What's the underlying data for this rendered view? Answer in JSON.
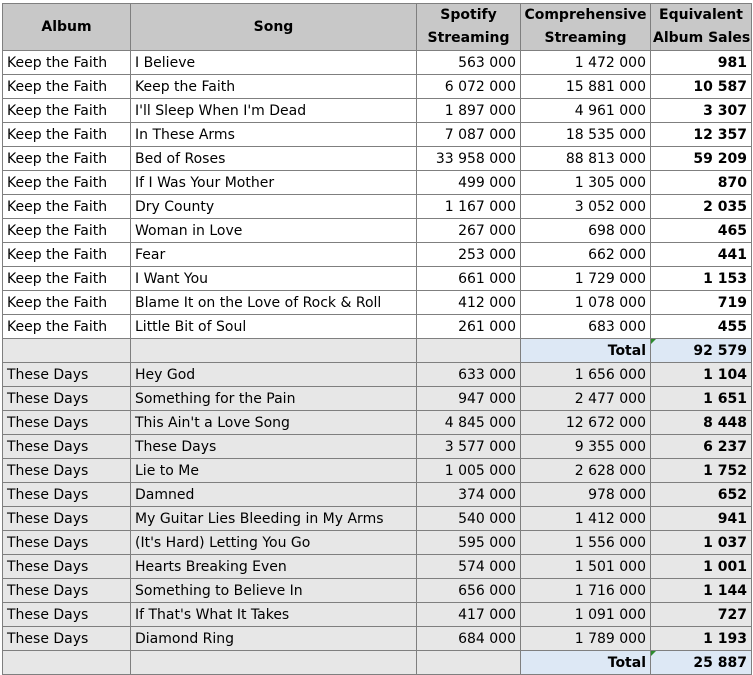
{
  "headers": {
    "album": "Album",
    "song": "Song",
    "spotify_l1": "Spotify",
    "spotify_l2": "Streaming",
    "comp_l1": "Comprehensive",
    "comp_l2": "Streaming",
    "eas_l1": "Equivalent",
    "eas_l2": "Album Sales"
  },
  "group1": {
    "rows": [
      {
        "album": "Keep the Faith",
        "song": "I Believe",
        "spotify": "563 000",
        "comprehensive": "1 472 000",
        "eas": "981"
      },
      {
        "album": "Keep the Faith",
        "song": "Keep the Faith",
        "spotify": "6 072 000",
        "comprehensive": "15 881 000",
        "eas": "10 587"
      },
      {
        "album": "Keep the Faith",
        "song": "I'll Sleep When I'm Dead",
        "spotify": "1 897 000",
        "comprehensive": "4 961 000",
        "eas": "3 307"
      },
      {
        "album": "Keep the Faith",
        "song": "In These Arms",
        "spotify": "7 087 000",
        "comprehensive": "18 535 000",
        "eas": "12 357"
      },
      {
        "album": "Keep the Faith",
        "song": "Bed of Roses",
        "spotify": "33 958 000",
        "comprehensive": "88 813 000",
        "eas": "59 209"
      },
      {
        "album": "Keep the Faith",
        "song": "If I Was Your Mother",
        "spotify": "499 000",
        "comprehensive": "1 305 000",
        "eas": "870"
      },
      {
        "album": "Keep the Faith",
        "song": "Dry County",
        "spotify": "1 167 000",
        "comprehensive": "3 052 000",
        "eas": "2 035"
      },
      {
        "album": "Keep the Faith",
        "song": "Woman in Love",
        "spotify": "267 000",
        "comprehensive": "698 000",
        "eas": "465"
      },
      {
        "album": "Keep the Faith",
        "song": "Fear",
        "spotify": "253 000",
        "comprehensive": "662 000",
        "eas": "441"
      },
      {
        "album": "Keep the Faith",
        "song": "I Want You",
        "spotify": "661 000",
        "comprehensive": "1 729 000",
        "eas": "1 153"
      },
      {
        "album": "Keep the Faith",
        "song": "Blame It on the Love of Rock & Roll",
        "spotify": "412 000",
        "comprehensive": "1 078 000",
        "eas": "719"
      },
      {
        "album": "Keep the Faith",
        "song": "Little Bit of Soul",
        "spotify": "261 000",
        "comprehensive": "683 000",
        "eas": "455"
      }
    ],
    "total_label": "Total",
    "total_value": "92 579"
  },
  "group2": {
    "rows": [
      {
        "album": "These Days",
        "song": "Hey God",
        "spotify": "633 000",
        "comprehensive": "1 656 000",
        "eas": "1 104"
      },
      {
        "album": "These Days",
        "song": "Something for the Pain",
        "spotify": "947 000",
        "comprehensive": "2 477 000",
        "eas": "1 651"
      },
      {
        "album": "These Days",
        "song": "This Ain't a Love Song",
        "spotify": "4 845 000",
        "comprehensive": "12 672 000",
        "eas": "8 448"
      },
      {
        "album": "These Days",
        "song": "These Days",
        "spotify": "3 577 000",
        "comprehensive": "9 355 000",
        "eas": "6 237"
      },
      {
        "album": "These Days",
        "song": "Lie to Me",
        "spotify": "1 005 000",
        "comprehensive": "2 628 000",
        "eas": "1 752"
      },
      {
        "album": "These Days",
        "song": "Damned",
        "spotify": "374 000",
        "comprehensive": "978 000",
        "eas": "652"
      },
      {
        "album": "These Days",
        "song": "My Guitar Lies Bleeding in My Arms",
        "spotify": "540 000",
        "comprehensive": "1 412 000",
        "eas": "941"
      },
      {
        "album": "These Days",
        "song": "(It's Hard) Letting You Go",
        "spotify": "595 000",
        "comprehensive": "1 556 000",
        "eas": "1 037"
      },
      {
        "album": "These Days",
        "song": "Hearts Breaking Even",
        "spotify": "574 000",
        "comprehensive": "1 501 000",
        "eas": "1 001"
      },
      {
        "album": "These Days",
        "song": "Something to Believe In",
        "spotify": "656 000",
        "comprehensive": "1 716 000",
        "eas": "1 144"
      },
      {
        "album": "These Days",
        "song": "If That's What It Takes",
        "spotify": "417 000",
        "comprehensive": "1 091 000",
        "eas": "727"
      },
      {
        "album": "These Days",
        "song": "Diamond Ring",
        "spotify": "684 000",
        "comprehensive": "1 789 000",
        "eas": "1 193"
      }
    ],
    "total_label": "Total",
    "total_value": "25 887"
  },
  "colors": {
    "header_bg": "#c8c8c8",
    "group2_bg": "#e7e7e7",
    "total_bg": "#dde8f5",
    "border": "#7f7f7f",
    "comment_marker": "#2e8b2e"
  }
}
